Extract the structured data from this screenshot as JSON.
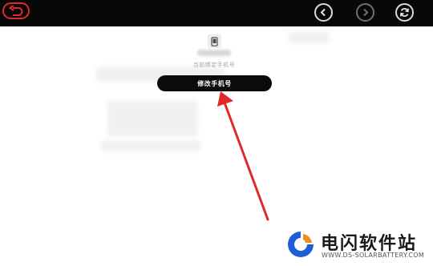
{
  "topbar": {
    "back_icon": "undo-arrow-icon",
    "prev_icon": "chevron-left-icon",
    "next_icon": "chevron-right-icon",
    "refresh_icon": "refresh-icon",
    "background": "#080808",
    "accent": "#e02a2a"
  },
  "main": {
    "phone_icon": "phone-icon",
    "caption": "当前绑定手机号",
    "change_phone_label": "修改手机号"
  },
  "annotation": {
    "arrow_color": "#e02a2a"
  },
  "watermark": {
    "title": "电闪软件站",
    "url": "WWW.DS-SOLARBATTERY.COM",
    "logo_colors": [
      "#1e5fd6",
      "#f28c1a"
    ]
  }
}
